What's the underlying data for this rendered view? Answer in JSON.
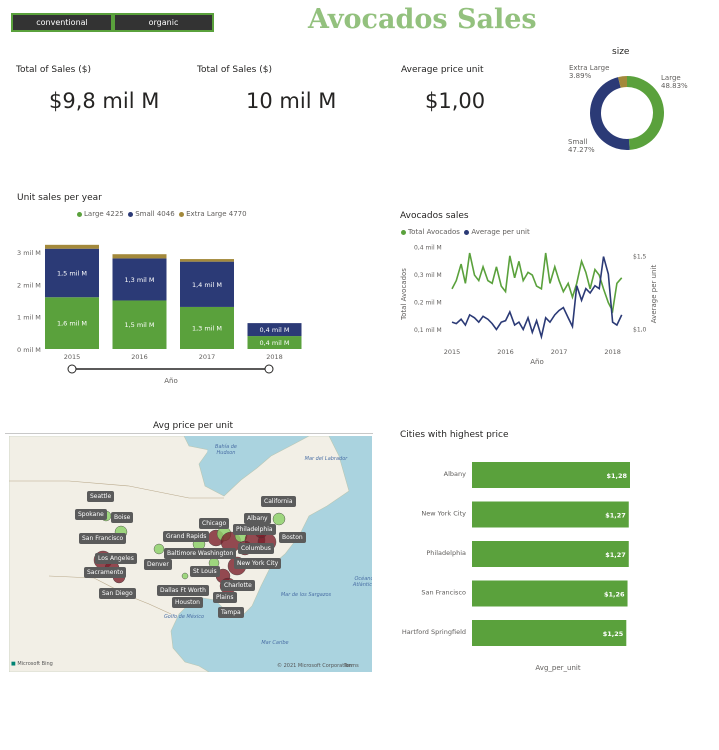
{
  "slicer": {
    "options": [
      "conventional",
      "organic"
    ]
  },
  "header": {
    "title": "Avocados Sales"
  },
  "kpis": [
    {
      "label": "Total of Sales ($)",
      "value": "$9,8 mil M"
    },
    {
      "label": "Total of Sales ($)",
      "value": "10 mil M"
    },
    {
      "label": "Average price unit",
      "value": "$1,00"
    }
  ],
  "colors": {
    "large": "#5aa13c",
    "small": "#2b3a76",
    "extra_large": "#a3893b",
    "map_bubble_red": "#7a1f2a",
    "map_bubble_green": "#8fd16b"
  },
  "chart_data": [
    {
      "type": "pie",
      "title": "size",
      "slices": [
        {
          "name": "Large",
          "value": 48.83,
          "label": "48.83%"
        },
        {
          "name": "Small",
          "value": 47.27,
          "label": "47.27%"
        },
        {
          "name": "Extra Large",
          "value": 3.89,
          "label": "3.89%"
        }
      ]
    },
    {
      "type": "bar",
      "title": "Unit sales per year",
      "xlabel": "Año",
      "categories": [
        "2015",
        "2016",
        "2017",
        "2018"
      ],
      "yticks": [
        "0 mil M",
        "1 mil M",
        "2 mil M",
        "3 mil M"
      ],
      "ylim": [
        0,
        3.4
      ],
      "legend": [
        "Large 4225",
        "Small 4046",
        "Extra Large 4770"
      ],
      "series": [
        {
          "name": "Large 4225",
          "values": [
            1.6,
            1.5,
            1.3,
            0.4
          ],
          "labels": [
            "1,6 mil M",
            "1,5 mil M",
            "1,3 mil M",
            "0,4 mil M"
          ]
        },
        {
          "name": "Small 4046",
          "values": [
            1.5,
            1.3,
            1.4,
            0.4
          ],
          "labels": [
            "1,5 mil M",
            "1,3 mil M",
            "1,4 mil M",
            "0,4 mil M"
          ]
        },
        {
          "name": "Extra Large 4770",
          "values": [
            0.12,
            0.13,
            0.08,
            0.0
          ],
          "labels": [
            "",
            "",
            "",
            ""
          ]
        }
      ]
    },
    {
      "type": "line",
      "title": "Avocados sales",
      "xlabel": "Año",
      "ylabel": "Total Avocados",
      "y2label": "Average per unit",
      "legend": [
        "Total Avocados",
        "Average per unit"
      ],
      "xticks": [
        "2015",
        "2016",
        "2017",
        "2018"
      ],
      "yticks": [
        "0,1 mil M",
        "0,2 mil M",
        "0,3 mil M",
        "0,4 mil M"
      ],
      "y2ticks": [
        "$1,0",
        "$1,5"
      ],
      "ylim": [
        0.05,
        0.42
      ],
      "y2lim": [
        0.9,
        1.6
      ],
      "xlim": [
        2015,
        2018.25
      ],
      "series": [
        {
          "name": "Total Avocados",
          "x": [
            2015.0,
            2015.08,
            2015.17,
            2015.25,
            2015.33,
            2015.42,
            2015.5,
            2015.58,
            2015.67,
            2015.75,
            2015.83,
            2015.92,
            2016.0,
            2016.08,
            2016.17,
            2016.25,
            2016.33,
            2016.42,
            2016.5,
            2016.58,
            2016.67,
            2016.75,
            2016.83,
            2016.92,
            2017.0,
            2017.08,
            2017.17,
            2017.25,
            2017.33,
            2017.42,
            2017.5,
            2017.58,
            2017.67,
            2017.75,
            2017.83,
            2017.92,
            2018.0,
            2018.08,
            2018.17
          ],
          "values": [
            0.25,
            0.28,
            0.34,
            0.27,
            0.38,
            0.3,
            0.28,
            0.33,
            0.28,
            0.27,
            0.33,
            0.26,
            0.24,
            0.37,
            0.29,
            0.35,
            0.28,
            0.31,
            0.3,
            0.26,
            0.25,
            0.38,
            0.27,
            0.33,
            0.28,
            0.24,
            0.27,
            0.22,
            0.27,
            0.35,
            0.31,
            0.25,
            0.32,
            0.3,
            0.25,
            0.2,
            0.17,
            0.27,
            0.29
          ]
        },
        {
          "name": "Average per unit",
          "x": [
            2015.0,
            2015.08,
            2015.17,
            2015.25,
            2015.33,
            2015.42,
            2015.5,
            2015.58,
            2015.67,
            2015.75,
            2015.83,
            2015.92,
            2016.0,
            2016.08,
            2016.17,
            2016.25,
            2016.33,
            2016.42,
            2016.5,
            2016.58,
            2016.67,
            2016.75,
            2016.83,
            2016.92,
            2017.0,
            2017.08,
            2017.17,
            2017.25,
            2017.33,
            2017.42,
            2017.5,
            2017.58,
            2017.67,
            2017.75,
            2017.83,
            2017.92,
            2018.0,
            2018.08,
            2018.17
          ],
          "values": [
            1.05,
            1.04,
            1.07,
            1.03,
            1.1,
            1.08,
            1.05,
            1.09,
            1.07,
            1.04,
            1.0,
            1.05,
            1.06,
            1.12,
            1.03,
            1.05,
            1.0,
            1.08,
            0.98,
            1.06,
            0.95,
            1.08,
            1.05,
            1.1,
            1.13,
            1.15,
            1.08,
            1.02,
            1.3,
            1.2,
            1.28,
            1.25,
            1.3,
            1.28,
            1.5,
            1.38,
            1.05,
            1.03,
            1.1
          ]
        }
      ]
    },
    {
      "type": "bar",
      "title": "Cities with highest price",
      "xlabel": "Avg_per_unit",
      "categories": [
        "Albany",
        "New York City",
        "Philadelphia",
        "San Francisco",
        "Hartford Springfield"
      ],
      "values": [
        1.28,
        1.27,
        1.27,
        1.26,
        1.25
      ],
      "labels": [
        "$1,28",
        "$1,27",
        "$1,27",
        "$1,26",
        "$1,25"
      ]
    }
  ],
  "map": {
    "title": "Avg price per unit",
    "labels": [
      "Seattle",
      "Spokane",
      "Boise",
      "San Francisco",
      "Los Angeles",
      "Sacramento",
      "San Diego",
      "Denver",
      "Grand Rapids",
      "Chicago",
      "Baltimore Washington",
      "Philadelphia",
      "Albany",
      "California",
      "Boston",
      "Columbus",
      "New York City",
      "St Louis",
      "Charlotte",
      "Dallas Ft Worth",
      "Plains",
      "Houston",
      "Tampa"
    ],
    "seas": [
      "Bahía de Hudson",
      "Mar del Labrador",
      "Mar de los Sargazos",
      "Golfo de México",
      "Mar Caribe",
      "Océano Atlántico"
    ],
    "attribution": "© 2021 Microsoft Corporation",
    "terms": "Terms",
    "brand": "Microsoft Bing"
  }
}
